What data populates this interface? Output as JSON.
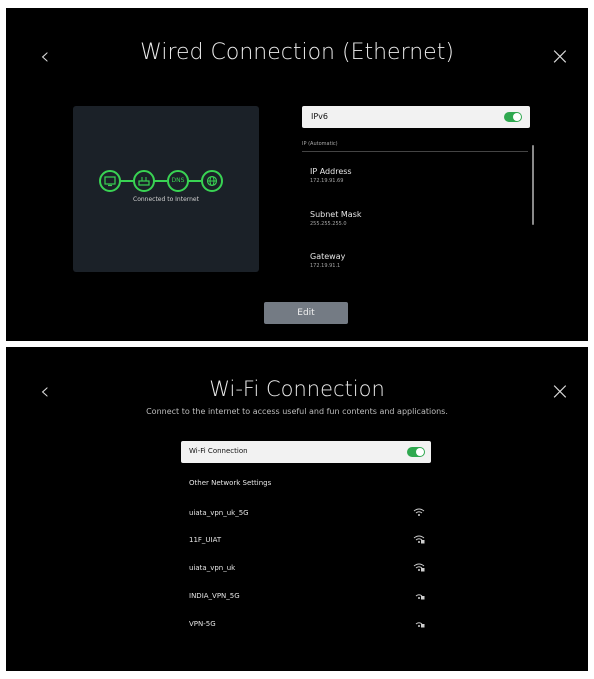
{
  "wired": {
    "title": "Wired Connection (Ethernet)",
    "back_icon": "‹",
    "close_icon": "×",
    "status": {
      "dns_label": "DNS",
      "status_text": "Connected to Internet"
    },
    "ipv6_label": "IPv6",
    "ipv6_enabled": true,
    "ip_mode": "IP (Automatic)",
    "fields": [
      {
        "label": "IP Address",
        "value": "172.19.91.69"
      },
      {
        "label": "Subnet Mask",
        "value": "255.255.255.0"
      },
      {
        "label": "Gateway",
        "value": "172.19.91.1"
      }
    ],
    "edit_label": "Edit"
  },
  "wifi": {
    "title": "Wi-Fi Connection",
    "back_icon": "‹",
    "close_icon": "×",
    "subtitle": "Connect to the internet to access useful and fun contents and applications.",
    "toggle_label": "Wi-Fi Connection",
    "toggle_enabled": true,
    "other_settings_label": "Other Network Settings",
    "networks": [
      {
        "name": "uiata_vpn_uk_5G",
        "icon": "wifi-icon",
        "locked": false
      },
      {
        "name": "11F_UIAT",
        "icon": "wifi-lock-icon",
        "locked": true
      },
      {
        "name": "uiata_vpn_uk",
        "icon": "wifi-lock-icon",
        "locked": true
      },
      {
        "name": "INDIA_VPN_5G",
        "icon": "wifi-lock-icon",
        "locked": true
      },
      {
        "name": "VPN-5G",
        "icon": "wifi-lock-icon",
        "locked": true
      }
    ]
  },
  "colors": {
    "accent_green": "#39d353",
    "toggle_on": "#2fa84f",
    "panel_bg": "#000000",
    "card_bg": "#1b2128",
    "edit_button_bg": "#747b84"
  }
}
